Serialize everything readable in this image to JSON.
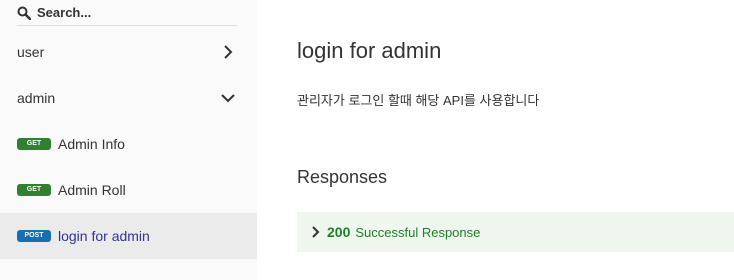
{
  "search": {
    "placeholder": "Search..."
  },
  "sidebar": {
    "groups": [
      {
        "label": "user",
        "expanded": false
      },
      {
        "label": "admin",
        "expanded": true
      }
    ],
    "operations": [
      {
        "method": "GET",
        "label": "Admin Info"
      },
      {
        "method": "GET",
        "label": "Admin Roll"
      },
      {
        "method": "POST",
        "label": "login for admin",
        "active": true
      }
    ]
  },
  "main": {
    "title": "login for admin",
    "description": "관리자가 로그인 할때 해당 API를 사용합니다",
    "responses_heading": "Responses",
    "responses": [
      {
        "code": "200",
        "text": "Successful Response",
        "color": "#1d8127"
      }
    ]
  },
  "colors": {
    "get": "#2f8132",
    "post": "#186faf",
    "active_link": "#32329f"
  }
}
